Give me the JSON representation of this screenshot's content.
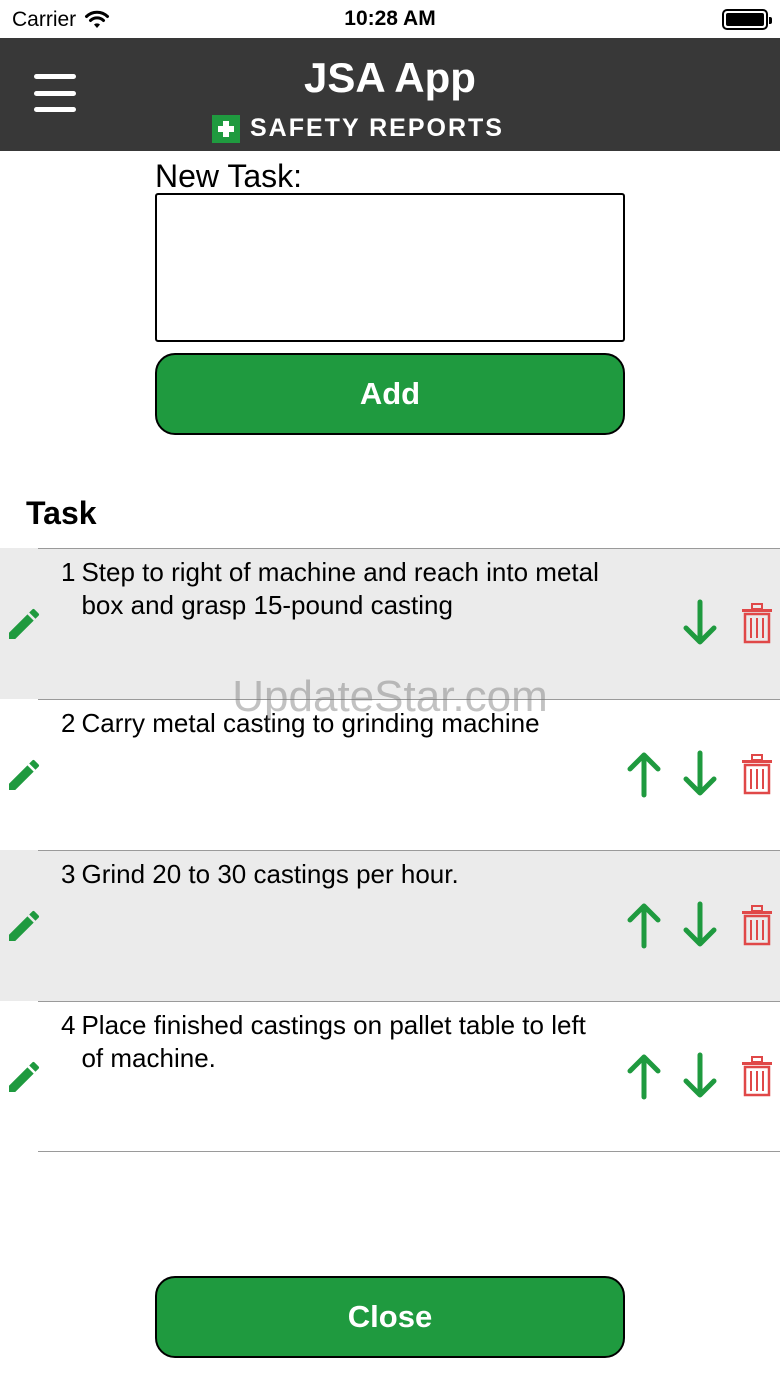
{
  "status_bar": {
    "carrier": "Carrier",
    "time": "10:28 AM"
  },
  "header": {
    "title": "JSA App",
    "brand": "SAFETY REPORTS"
  },
  "form": {
    "label": "New Task:",
    "input_value": "",
    "add_label": "Add"
  },
  "tasks_section": {
    "title": "Task"
  },
  "tasks": [
    {
      "number": "1",
      "text": "Step to right of machine and reach into metal box and grasp 15-pound casting"
    },
    {
      "number": "2",
      "text": "Carry metal casting to grinding machine"
    },
    {
      "number": "3",
      "text": "Grind 20 to 30 castings per hour."
    },
    {
      "number": "4",
      "text": "Place finished castings on pallet table to left of machine."
    }
  ],
  "close_label": "Close",
  "watermark": "UpdateStar.com",
  "colors": {
    "header_bg": "#383838",
    "accent_green": "#1f9a3f",
    "delete_red": "#e04848",
    "row_shade": "#ebebeb"
  },
  "icons": {
    "menu": "hamburger-menu-icon",
    "edit": "pencil-icon",
    "up": "arrow-up-icon",
    "down": "arrow-down-icon",
    "delete": "trash-icon"
  }
}
